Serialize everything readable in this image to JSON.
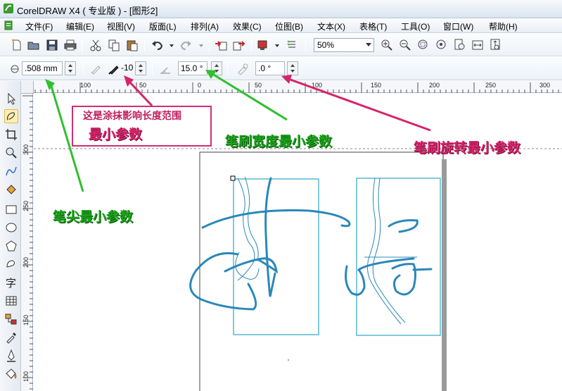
{
  "window": {
    "title": "CorelDRAW X4 ( 专业版 ) - [图形2]"
  },
  "menu": [
    "文件(F)",
    "编辑(E)",
    "视图(V)",
    "版面(L)",
    "排列(A)",
    "效果(C)",
    "位图(B)",
    "文本(X)",
    "表格(T)",
    "工具(O)",
    "窗口(W)",
    "帮助(H)"
  ],
  "standard_toolbar": {
    "zoom": "50%"
  },
  "property_bar": {
    "nib_size": ".508 mm",
    "smear_length": "-10",
    "brush_width": "15.0 °",
    "brush_rotation": ".0 °"
  },
  "rulers": {
    "horizontal": [
      "100",
      "50",
      "0",
      "50",
      "100",
      "150",
      "200",
      "250",
      "300"
    ],
    "vertical": [
      "300",
      "250",
      "200",
      "150",
      "100"
    ]
  },
  "annotations": {
    "note_line1": "这是涂抹影响长度范围",
    "note_line2": "最小参数",
    "width_label": "笔刷宽度最小参数",
    "rotation_label": "笔刷旋转最小参数",
    "nib_label": "笔尖最小参数"
  },
  "colors": {
    "green_annotation": "#18a418",
    "pink_annotation": "#d6246c",
    "stroke_teal": "#2a88b8",
    "frame_teal": "#2ba8c2"
  },
  "icons": {
    "toolbox": [
      "pick-tool-icon",
      "freehand-smear-tool-icon",
      "crop-tool-icon",
      "zoom-tool-icon",
      "curve-tool-icon",
      "smart-fill-tool-icon",
      "rectangle-tool-icon",
      "ellipse-tool-icon",
      "polygon-tool-icon",
      "basic-shapes-tool-icon",
      "text-tool-icon",
      "table-tool-icon",
      "connector-tool-icon",
      "eyedropper-tool-icon",
      "outline-tool-icon",
      "fill-tool-icon"
    ]
  }
}
